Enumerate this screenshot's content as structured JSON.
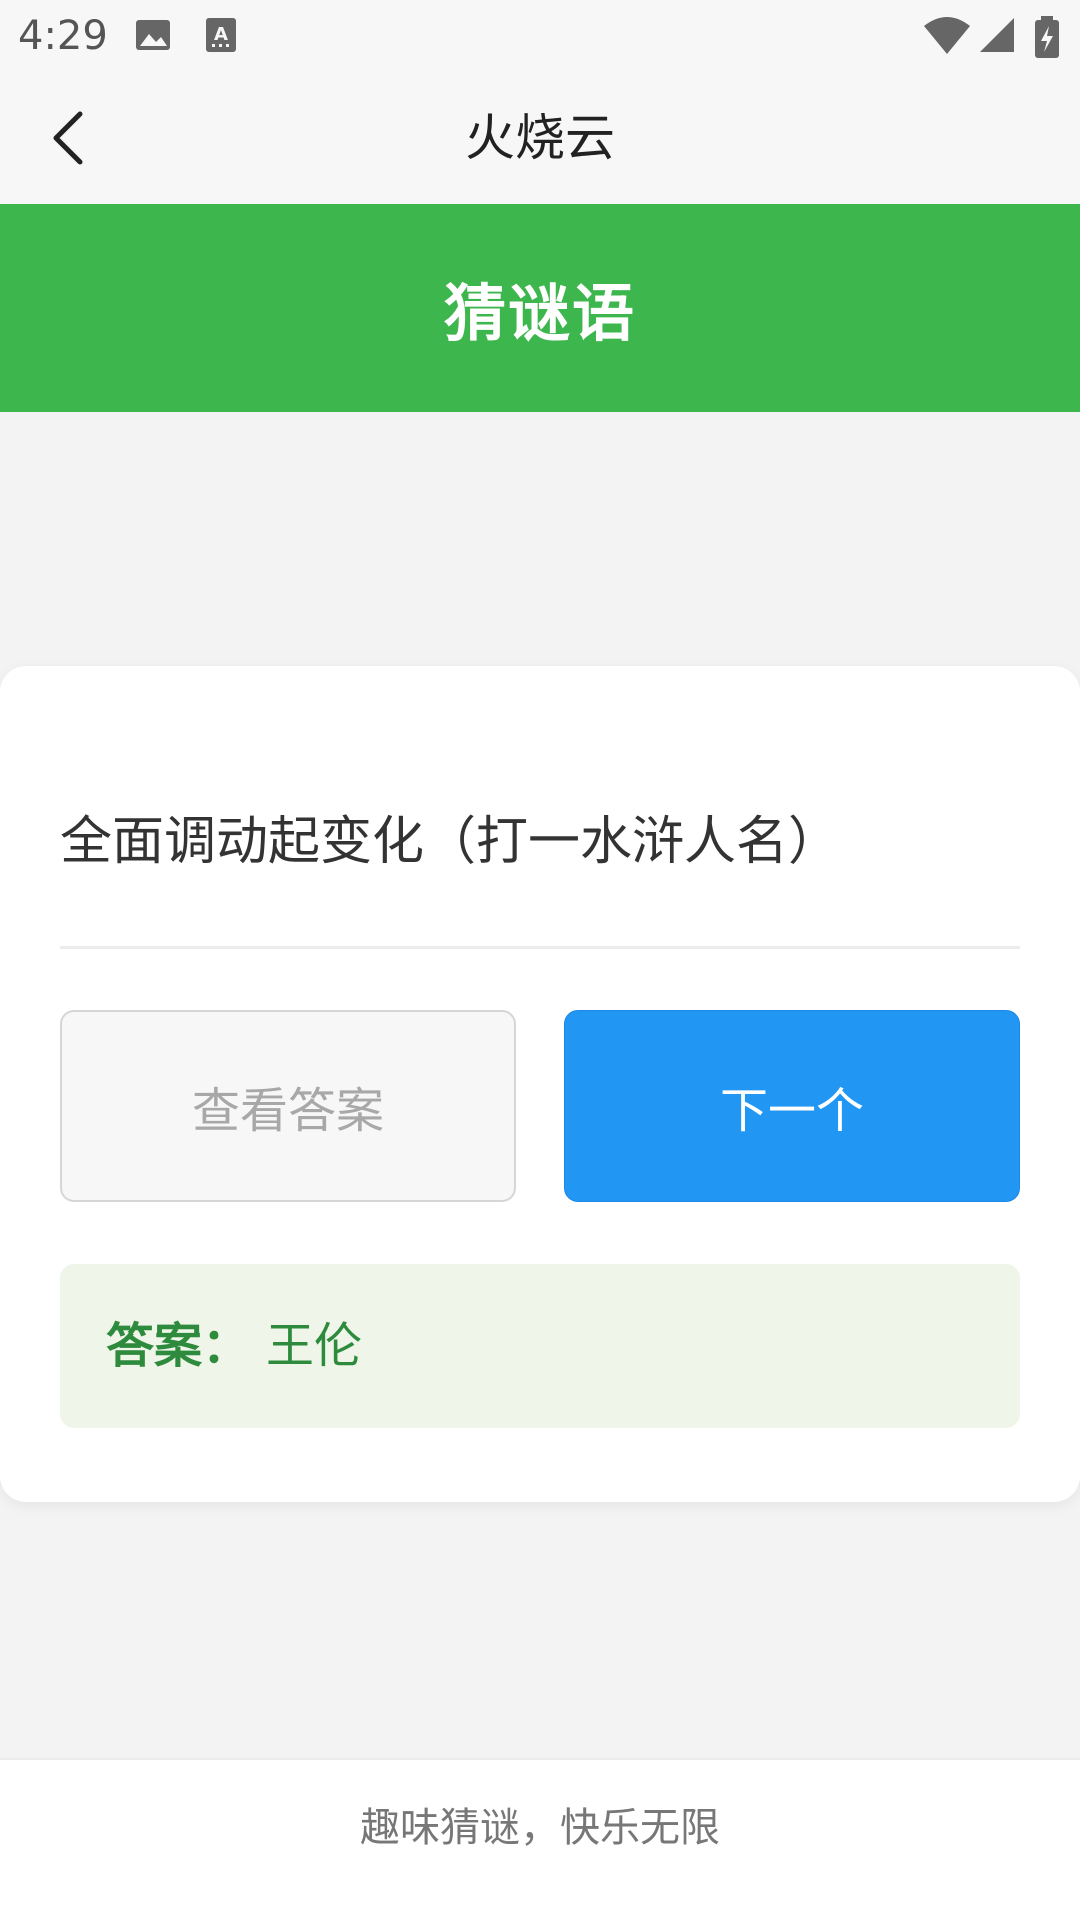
{
  "status_bar": {
    "time": "4:29",
    "icons": [
      "image-icon",
      "text-recognition-icon",
      "wifi-icon",
      "signal-icon",
      "battery-charging-icon"
    ]
  },
  "app_bar": {
    "title": "火烧云",
    "back_icon": "chevron-left-icon"
  },
  "banner": {
    "title": "猜谜语",
    "color": "#3db64d"
  },
  "riddle": {
    "question": "全面调动起变化（打一水浒人名）",
    "show_answer_label": "查看答案",
    "next_label": "下一个",
    "answer_label": "答案：",
    "answer_value": "王伦"
  },
  "footer": {
    "text": "趣味猜谜，快乐无限"
  },
  "colors": {
    "primary_green": "#3db64d",
    "button_blue": "#2196f3",
    "answer_green": "#2e8b3d",
    "answer_bg": "#eff6e9"
  }
}
